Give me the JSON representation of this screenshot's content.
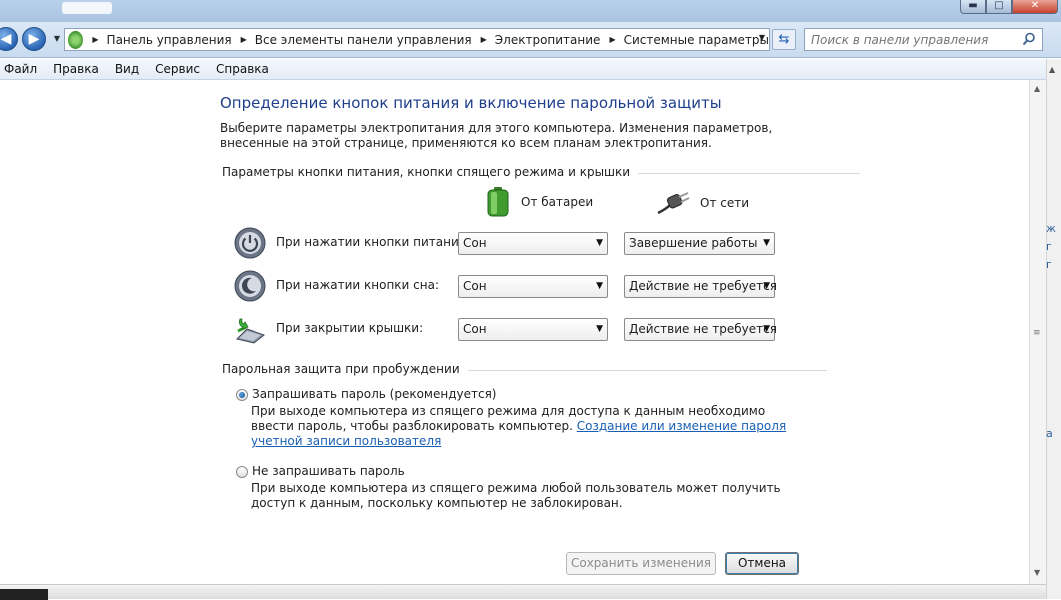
{
  "breadcrumb": [
    "Панель управления",
    "Все элементы панели управления",
    "Электропитание",
    "Системные параметры"
  ],
  "search": {
    "placeholder": "Поиск в панели управления"
  },
  "menu": [
    "Файл",
    "Правка",
    "Вид",
    "Сервис",
    "Справка"
  ],
  "main": {
    "title": "Определение кнопок питания и включение парольной защиты",
    "description": "Выберите параметры электропитания для этого компьютера. Изменения параметров, внесенные на этой странице, применяются ко всем планам электропитания.",
    "power_section": {
      "heading": "Параметры кнопки питания, кнопки спящего режима и крышки",
      "battery_label": "От батареи",
      "ac_label": "От сети",
      "rows": [
        {
          "label": "При нажатии кнопки питания:",
          "battery": "Сон",
          "ac": "Завершение работы",
          "icon": "power-button-icon"
        },
        {
          "label": "При нажатии кнопки сна:",
          "battery": "Сон",
          "ac": "Действие не требуется",
          "icon": "sleep-button-icon"
        },
        {
          "label": "При закрытии крышки:",
          "battery": "Сон",
          "ac": "Действие не требуется",
          "icon": "laptop-lid-icon"
        }
      ]
    },
    "password_section": {
      "heading": "Парольная защита при пробуждении",
      "require": {
        "label": "Запрашивать пароль (рекомендуется)",
        "desc": "При выходе компьютера из спящего режима для доступа к данным необходимо ввести пароль, чтобы разблокировать компьютер.",
        "link": "Создание или изменение пароля учетной записи пользователя",
        "checked": true
      },
      "no_require": {
        "label": "Не запрашивать пароль",
        "desc": "При выходе компьютера из спящего режима любой пользователь может получить доступ к данным, поскольку компьютер не заблокирован.",
        "checked": false
      }
    }
  },
  "buttons": {
    "save": "Сохранить изменения",
    "cancel": "Отмена"
  },
  "bg_snippets": [
    "ж",
    "г",
    "г",
    "а"
  ],
  "colors": {
    "title": "#1e3f8c",
    "link": "#1a5fb4",
    "accent": "#2a64b3"
  }
}
